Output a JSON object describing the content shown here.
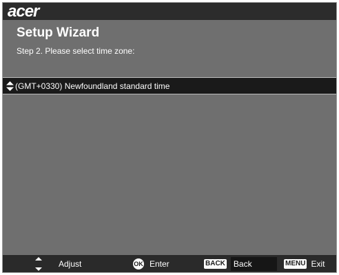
{
  "brand": {
    "logo_text": "acer"
  },
  "wizard": {
    "title": "Setup Wizard",
    "step_prompt": "Step 2. Please select time zone:"
  },
  "timezone_select": {
    "icon": "up-down-arrows-icon",
    "selected_value": "(GMT+0330) Newfoundland standard time"
  },
  "footer": {
    "adjust": {
      "icon": "up-down-arrows-icon",
      "label": "Adjust"
    },
    "enter": {
      "key": "OK",
      "label": "Enter"
    },
    "back": {
      "key": "BACK",
      "label": "Back"
    },
    "exit": {
      "key": "MENU",
      "label": "Exit"
    }
  },
  "colors": {
    "panel_bg": "#6f6f6f",
    "bar_bg": "#2c2c2c",
    "selected_row_bg": "#1a1a1a",
    "text": "#ffffff"
  }
}
